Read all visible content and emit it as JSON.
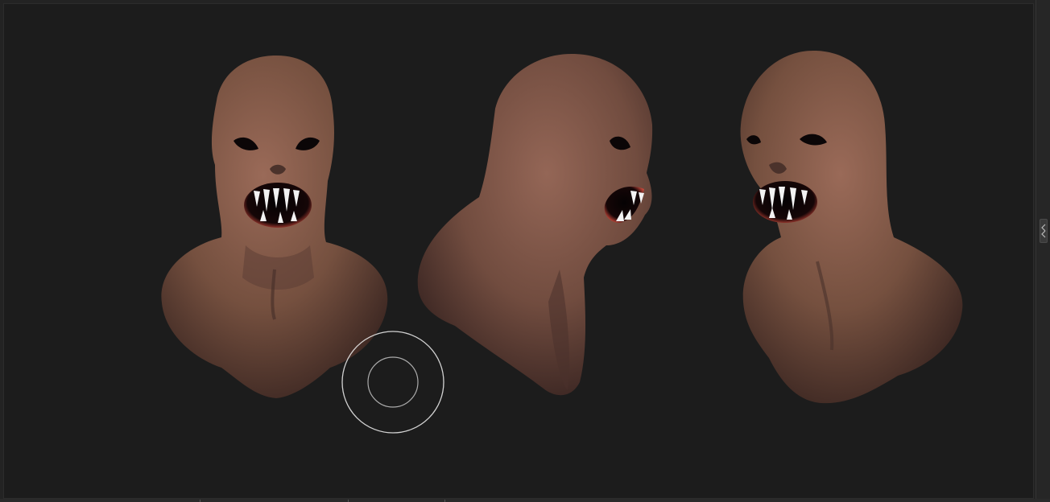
{
  "viewport": {
    "background": "#1c1c1c",
    "models": [
      {
        "view": "front"
      },
      {
        "view": "side"
      },
      {
        "view": "three-quarter"
      }
    ]
  },
  "colors": {
    "skin": "#7a5548",
    "skin_dark": "#3e2a26",
    "mouth": "#0a0505",
    "gum": "#d24a3a",
    "teeth": "#f2f2f2",
    "cursor": "#e8e8e8"
  },
  "icons": {
    "brush_cursor": "double-circle-cursor-icon",
    "tray_handle": "chevron-arrows-icon"
  }
}
